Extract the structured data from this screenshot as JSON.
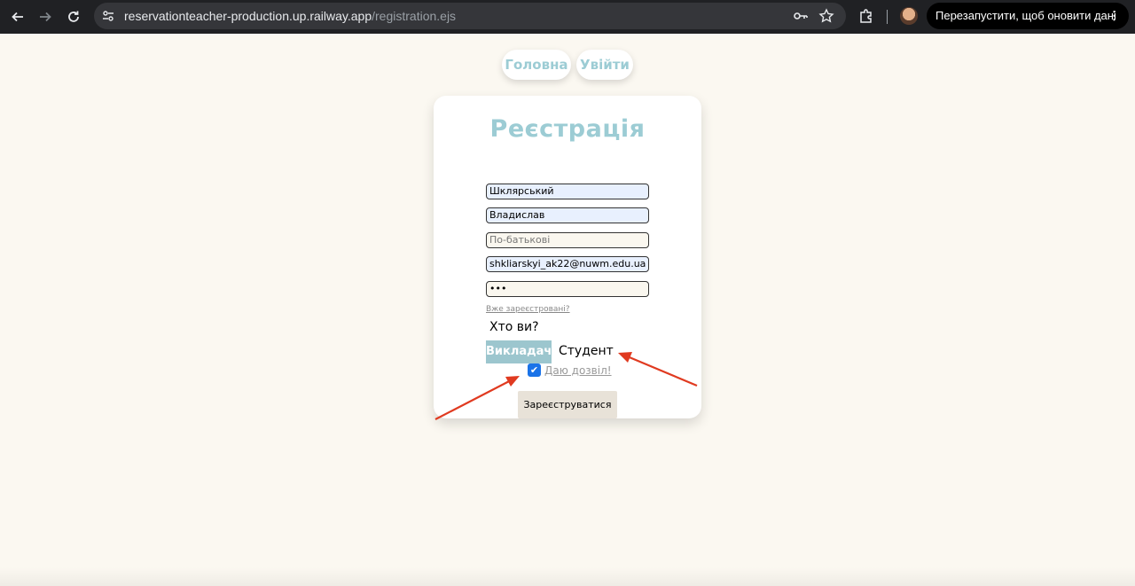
{
  "browser": {
    "url_host": "reservationteacher-production.up.railway.app",
    "url_path": "/registration.ejs",
    "restart_label": "Перезапустити, щоб оновити дані",
    "menu_dots": "⋮"
  },
  "nav": {
    "home_label": "Головна",
    "login_label": "Увійти"
  },
  "form": {
    "title": "Реєстрація",
    "last_name": "Шклярський",
    "first_name": "Владислав",
    "patronymic_placeholder": "По-батькові",
    "email": "shkliarskyi_ak22@nuwm.edu.ua",
    "password_mask": "•••",
    "already_registered": "Вже зареєстровані?",
    "who_are_you": "Хто ви?",
    "role_teacher": "Викладач",
    "role_student": "Студент",
    "consent_label": "Даю дозвіл!",
    "consent_checked": true,
    "submit_label": "Зареєструватися"
  },
  "colors": {
    "accent": "#9cccd4",
    "page_bg": "#fbf8f1",
    "arrow": "#e03a20"
  }
}
